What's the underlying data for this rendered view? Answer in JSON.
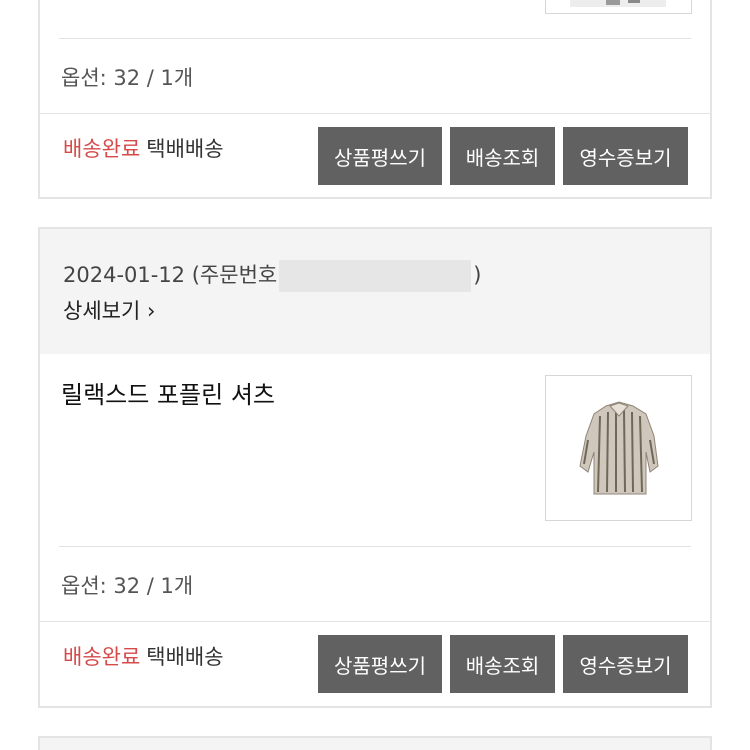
{
  "orders": [
    {
      "option_label": "옵션: 32 /  1개",
      "status": "배송완료",
      "shipping_method": "택배배송",
      "buttons": {
        "review": "상품평쓰기",
        "track": "배송조회",
        "receipt": "영수증보기"
      }
    },
    {
      "date": "2024-01-12",
      "order_no_prefix": "(주문번호",
      "order_no_suffix": ")",
      "detail_link": "상세보기",
      "detail_chevron": "›",
      "product_name": "릴랙스드 포플린 셔츠",
      "option_label": "옵션: 32 /  1개",
      "status": "배송완료",
      "shipping_method": "택배배송",
      "buttons": {
        "review": "상품평쓰기",
        "track": "배송조회",
        "receipt": "영수증보기"
      }
    }
  ],
  "colors": {
    "status_done": "#d64a4a",
    "button_bg": "#616161",
    "order_head_bg": "#f4f4f4"
  },
  "icons": {
    "product_thumb": "shirt-image"
  }
}
